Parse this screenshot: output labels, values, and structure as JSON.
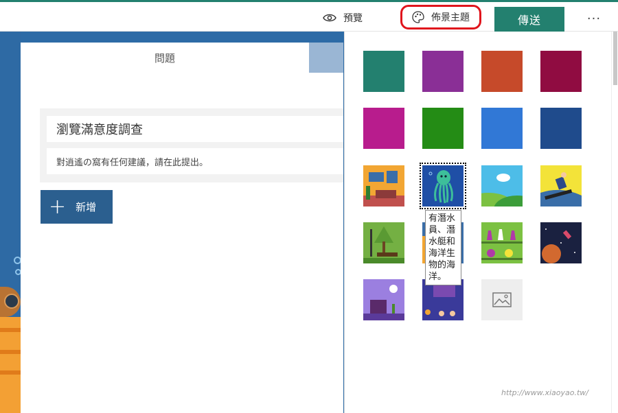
{
  "topbar": {
    "preview_label": "預覽",
    "theme_label": "佈景主題",
    "send_label": "傳送",
    "more_label": "···"
  },
  "form": {
    "tab_questions": "問題",
    "title": "瀏覽滿意度調查",
    "description": "對逍遙の窩有任何建議，請在此提出。",
    "add_label": "新增"
  },
  "themes": {
    "solid_colors": [
      "#23806f",
      "#8a2f96",
      "#c64a2a",
      "#900c41",
      "#b81c8d",
      "#248c15",
      "#3178d6",
      "#1f4b8c"
    ],
    "tooltip": "有潛水員、潛水艇和海洋生物的海洋。"
  },
  "watermark": "http://www.xiaoyao.tw/"
}
